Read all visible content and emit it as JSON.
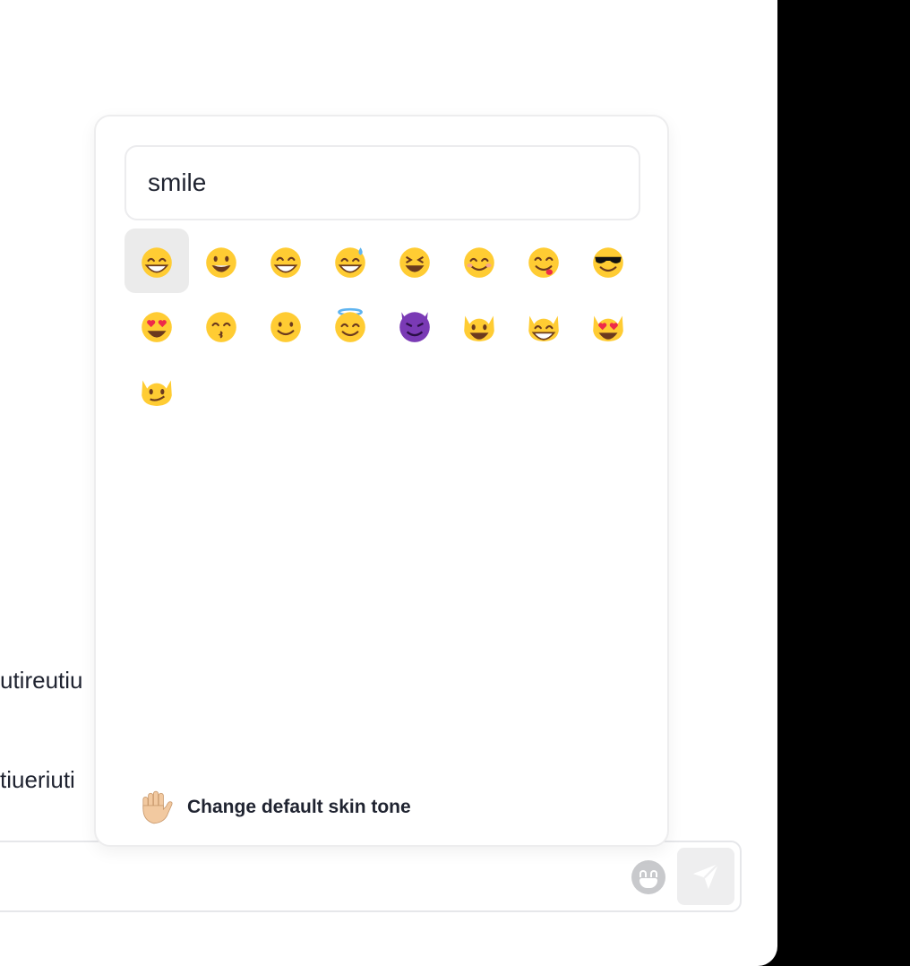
{
  "chat": {
    "messages": [
      "utireutiu",
      "tiueriuti"
    ]
  },
  "emoji_picker": {
    "search_value": "smile",
    "selected_index": 0,
    "results": [
      {
        "name": "grinning-face-with-smiling-eyes-icon"
      },
      {
        "name": "grinning-face-with-big-eyes-icon"
      },
      {
        "name": "beaming-face-icon"
      },
      {
        "name": "grinning-face-with-sweat-icon"
      },
      {
        "name": "grinning-squinting-face-icon"
      },
      {
        "name": "smiling-face-with-smiling-eyes-icon"
      },
      {
        "name": "face-savoring-food-icon"
      },
      {
        "name": "smiling-face-with-sunglasses-icon"
      },
      {
        "name": "smiling-face-with-heart-eyes-icon"
      },
      {
        "name": "kissing-face-with-smiling-eyes-icon"
      },
      {
        "name": "slightly-smiling-face-icon"
      },
      {
        "name": "smiling-face-with-halo-icon"
      },
      {
        "name": "smiling-face-with-horns-icon"
      },
      {
        "name": "grinning-cat-icon"
      },
      {
        "name": "grinning-cat-with-smiling-eyes-icon"
      },
      {
        "name": "smiling-cat-with-heart-eyes-icon"
      },
      {
        "name": "cat-with-wry-smile-icon"
      }
    ],
    "skin_tone_label": "Change default skin tone",
    "skin_tone_icon": "raised-hand-icon"
  },
  "composer": {
    "emoji_button_icon": "smiley-icon",
    "send_button_icon": "paper-plane-icon"
  },
  "colors": {
    "emoji_yellow": "#FFCC33",
    "emoji_dark": "#6B3A1E",
    "heart_red": "#EE2A4A",
    "devil_purple": "#7A3AB5",
    "halo_blue": "#5FB4F0",
    "text": "#1F2330"
  }
}
